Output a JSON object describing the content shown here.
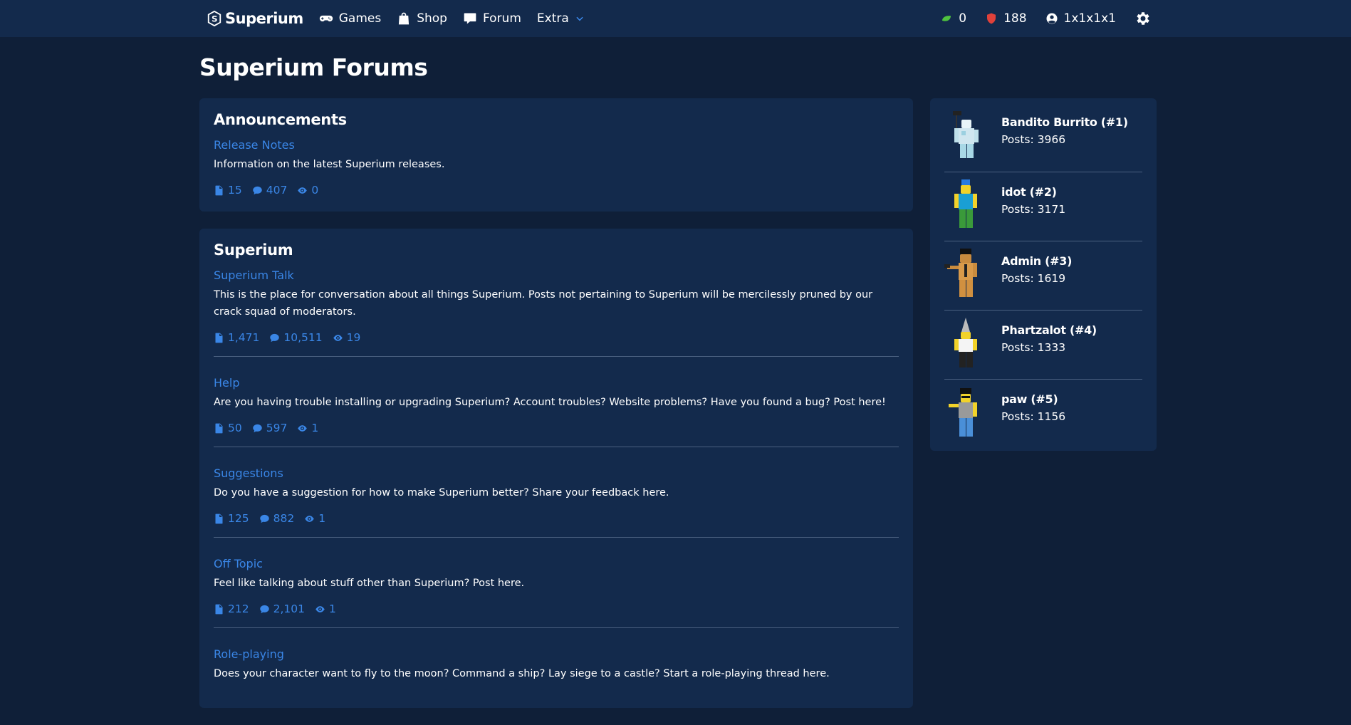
{
  "nav": {
    "brand": "Superium",
    "links": [
      {
        "label": "Games",
        "icon": "gamepad-icon"
      },
      {
        "label": "Shop",
        "icon": "shopping-bag-icon"
      },
      {
        "label": "Forum",
        "icon": "comment-icon"
      },
      {
        "label": "Extra",
        "icon": "chevron-down-icon"
      }
    ],
    "currency_green": "0",
    "currency_red": "188",
    "username": "1x1x1x1"
  },
  "page": {
    "title": "Superium Forums"
  },
  "categories": [
    {
      "title": "Announcements",
      "forums": [
        {
          "name": "Release Notes",
          "desc": "Information on the latest Superium releases.",
          "threads": "15",
          "posts": "407",
          "viewing": "0"
        }
      ]
    },
    {
      "title": "Superium",
      "forums": [
        {
          "name": "Superium Talk",
          "desc": "This is the place for conversation about all things Superium. Posts not pertaining to Superium will be mercilessly pruned by our crack squad of moderators.",
          "threads": "1,471",
          "posts": "10,511",
          "viewing": "19"
        },
        {
          "name": "Help",
          "desc": "Are you having trouble installing or upgrading Superium? Account troubles? Website problems? Have you found a bug? Post here!",
          "threads": "50",
          "posts": "597",
          "viewing": "1"
        },
        {
          "name": "Suggestions",
          "desc": "Do you have a suggestion for how to make Superium better? Share your feedback here.",
          "threads": "125",
          "posts": "882",
          "viewing": "1"
        },
        {
          "name": "Off Topic",
          "desc": "Feel like talking about stuff other than Superium? Post here.",
          "threads": "212",
          "posts": "2,101",
          "viewing": "1"
        },
        {
          "name": "Role-playing",
          "desc": "Does your character want to fly to the moon? Command a ship? Lay siege to a castle? Start a role-playing thread here.",
          "threads": "",
          "posts": "",
          "viewing": ""
        }
      ]
    }
  ],
  "top_posters": [
    {
      "name": "Bandito Burrito (#1)",
      "posts": "Posts: 3966"
    },
    {
      "name": "idot (#2)",
      "posts": "Posts: 3171"
    },
    {
      "name": "Admin (#3)",
      "posts": "Posts: 1619"
    },
    {
      "name": "Phartzalot (#4)",
      "posts": "Posts: 1333"
    },
    {
      "name": "paw (#5)",
      "posts": "Posts: 1156"
    }
  ],
  "colors": {
    "accent": "#3a86e6",
    "background": "#0f1f38",
    "card": "#132a4c",
    "green": "#4fc23f",
    "red": "#e0413a"
  }
}
